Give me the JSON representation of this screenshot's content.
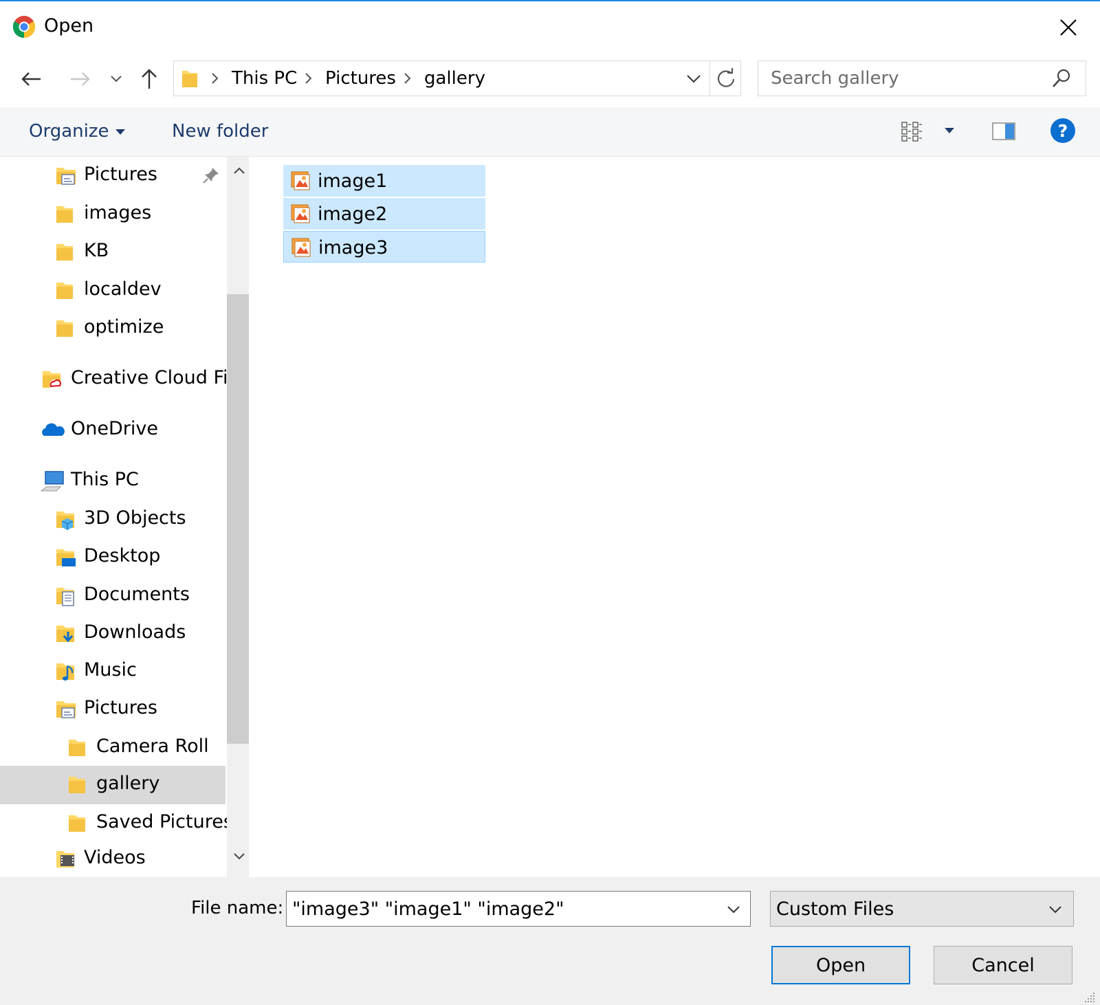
{
  "window": {
    "title": "Open"
  },
  "address": {
    "crumbs": [
      "This PC",
      "Pictures",
      "gallery"
    ]
  },
  "search": {
    "placeholder": "Search gallery"
  },
  "toolbar": {
    "organize": "Organize",
    "new_folder": "New folder"
  },
  "nav": {
    "items": [
      {
        "label": "Pictures",
        "icon": "pictures-folder-icon",
        "pinned": true
      },
      {
        "label": "images",
        "icon": "folder-icon"
      },
      {
        "label": "KB",
        "icon": "folder-icon"
      },
      {
        "label": "localdev",
        "icon": "folder-icon"
      },
      {
        "label": "optimize",
        "icon": "folder-icon"
      },
      {
        "label": "Creative Cloud Files",
        "icon": "creative-cloud-icon"
      },
      {
        "label": "OneDrive",
        "icon": "onedrive-icon"
      },
      {
        "label": "This PC",
        "icon": "computer-icon"
      },
      {
        "label": "3D Objects",
        "icon": "3d-objects-icon"
      },
      {
        "label": "Desktop",
        "icon": "desktop-icon"
      },
      {
        "label": "Documents",
        "icon": "documents-icon"
      },
      {
        "label": "Downloads",
        "icon": "downloads-icon"
      },
      {
        "label": "Music",
        "icon": "music-icon"
      },
      {
        "label": "Pictures",
        "icon": "pictures-folder-icon"
      },
      {
        "label": "Camera Roll",
        "icon": "folder-icon"
      },
      {
        "label": "gallery",
        "icon": "folder-icon",
        "selected": true
      },
      {
        "label": "Saved Pictures",
        "icon": "folder-icon"
      },
      {
        "label": "Videos",
        "icon": "videos-icon"
      }
    ]
  },
  "files": [
    {
      "name": "image1",
      "icon": "image-file-icon",
      "selected": true
    },
    {
      "name": "image2",
      "icon": "image-file-icon",
      "selected": true
    },
    {
      "name": "image3",
      "icon": "image-file-icon",
      "selected": true,
      "focused": true
    }
  ],
  "bottom": {
    "file_name_label": "File name:",
    "file_name_value": "\"image3\" \"image1\" \"image2\"",
    "filter_value": "Custom Files",
    "open_label": "Open",
    "cancel_label": "Cancel"
  },
  "colors": {
    "accent": "#0078d7",
    "selection": "#cce8ff",
    "toolbar_text": "#1e3c6e",
    "help": "#0a6fd1"
  }
}
